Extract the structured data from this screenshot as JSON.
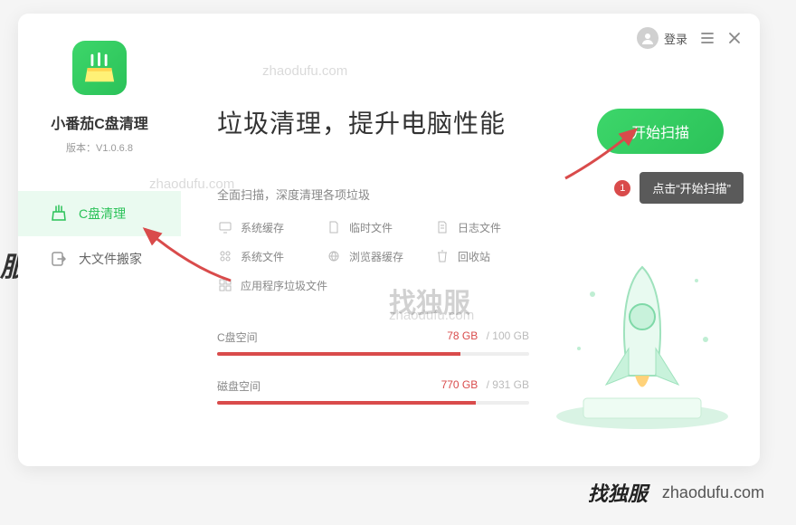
{
  "sidebar": {
    "appTitle": "小番茄C盘清理",
    "versionPrefix": "版本：",
    "version": "V1.0.6.8",
    "items": [
      {
        "label": "C盘清理",
        "icon": "broom-icon",
        "active": true
      },
      {
        "label": "大文件搬家",
        "icon": "move-icon",
        "active": false
      }
    ]
  },
  "topbar": {
    "login": "登录"
  },
  "main": {
    "headline": "垃圾清理，提升电脑性能",
    "scanButton": "开始扫描",
    "subhead": "全面扫描，深度清理各项垃圾",
    "categories": [
      "系统缓存",
      "临时文件",
      "日志文件",
      "系统文件",
      "浏览器缓存",
      "回收站",
      "应用程序垃圾文件"
    ]
  },
  "disks": [
    {
      "label": "C盘空间",
      "used": "78 GB",
      "total": "100 GB",
      "pct": 78
    },
    {
      "label": "磁盘空间",
      "used": "770 GB",
      "total": "931 GB",
      "pct": 83
    }
  ],
  "tooltip": {
    "badge": "1",
    "text": "点击“开始扫描”"
  },
  "watermarks": {
    "text": "zhaodufu.com",
    "brand": "找独服"
  },
  "footer": {
    "brand": "找独服",
    "url": "zhaodufu.com"
  }
}
